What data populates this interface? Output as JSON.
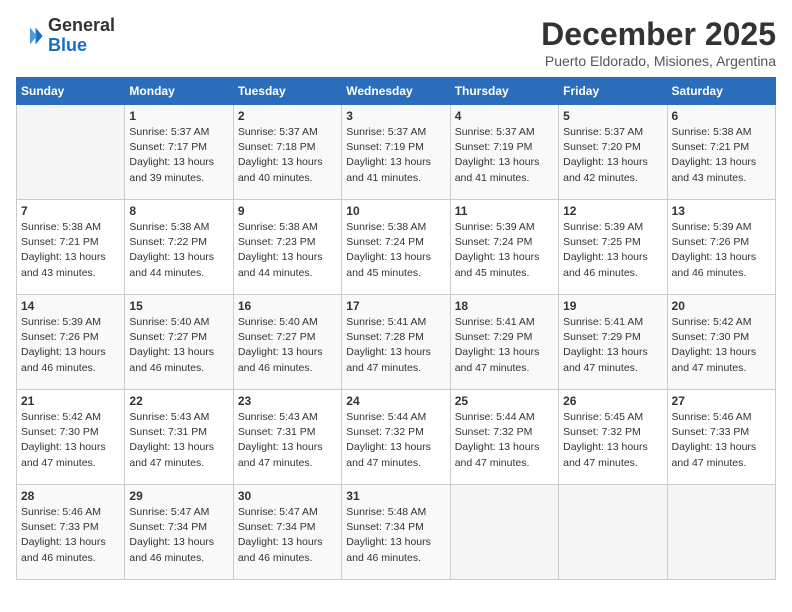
{
  "header": {
    "logo": {
      "general": "General",
      "blue": "Blue"
    },
    "title": "December 2025",
    "location": "Puerto Eldorado, Misiones, Argentina"
  },
  "calendar": {
    "days_of_week": [
      "Sunday",
      "Monday",
      "Tuesday",
      "Wednesday",
      "Thursday",
      "Friday",
      "Saturday"
    ],
    "weeks": [
      [
        {
          "day": "",
          "info": ""
        },
        {
          "day": "1",
          "info": "Sunrise: 5:37 AM\nSunset: 7:17 PM\nDaylight: 13 hours\nand 39 minutes."
        },
        {
          "day": "2",
          "info": "Sunrise: 5:37 AM\nSunset: 7:18 PM\nDaylight: 13 hours\nand 40 minutes."
        },
        {
          "day": "3",
          "info": "Sunrise: 5:37 AM\nSunset: 7:19 PM\nDaylight: 13 hours\nand 41 minutes."
        },
        {
          "day": "4",
          "info": "Sunrise: 5:37 AM\nSunset: 7:19 PM\nDaylight: 13 hours\nand 41 minutes."
        },
        {
          "day": "5",
          "info": "Sunrise: 5:37 AM\nSunset: 7:20 PM\nDaylight: 13 hours\nand 42 minutes."
        },
        {
          "day": "6",
          "info": "Sunrise: 5:38 AM\nSunset: 7:21 PM\nDaylight: 13 hours\nand 43 minutes."
        }
      ],
      [
        {
          "day": "7",
          "info": "Sunrise: 5:38 AM\nSunset: 7:21 PM\nDaylight: 13 hours\nand 43 minutes."
        },
        {
          "day": "8",
          "info": "Sunrise: 5:38 AM\nSunset: 7:22 PM\nDaylight: 13 hours\nand 44 minutes."
        },
        {
          "day": "9",
          "info": "Sunrise: 5:38 AM\nSunset: 7:23 PM\nDaylight: 13 hours\nand 44 minutes."
        },
        {
          "day": "10",
          "info": "Sunrise: 5:38 AM\nSunset: 7:24 PM\nDaylight: 13 hours\nand 45 minutes."
        },
        {
          "day": "11",
          "info": "Sunrise: 5:39 AM\nSunset: 7:24 PM\nDaylight: 13 hours\nand 45 minutes."
        },
        {
          "day": "12",
          "info": "Sunrise: 5:39 AM\nSunset: 7:25 PM\nDaylight: 13 hours\nand 46 minutes."
        },
        {
          "day": "13",
          "info": "Sunrise: 5:39 AM\nSunset: 7:26 PM\nDaylight: 13 hours\nand 46 minutes."
        }
      ],
      [
        {
          "day": "14",
          "info": "Sunrise: 5:39 AM\nSunset: 7:26 PM\nDaylight: 13 hours\nand 46 minutes."
        },
        {
          "day": "15",
          "info": "Sunrise: 5:40 AM\nSunset: 7:27 PM\nDaylight: 13 hours\nand 46 minutes."
        },
        {
          "day": "16",
          "info": "Sunrise: 5:40 AM\nSunset: 7:27 PM\nDaylight: 13 hours\nand 46 minutes."
        },
        {
          "day": "17",
          "info": "Sunrise: 5:41 AM\nSunset: 7:28 PM\nDaylight: 13 hours\nand 47 minutes."
        },
        {
          "day": "18",
          "info": "Sunrise: 5:41 AM\nSunset: 7:29 PM\nDaylight: 13 hours\nand 47 minutes."
        },
        {
          "day": "19",
          "info": "Sunrise: 5:41 AM\nSunset: 7:29 PM\nDaylight: 13 hours\nand 47 minutes."
        },
        {
          "day": "20",
          "info": "Sunrise: 5:42 AM\nSunset: 7:30 PM\nDaylight: 13 hours\nand 47 minutes."
        }
      ],
      [
        {
          "day": "21",
          "info": "Sunrise: 5:42 AM\nSunset: 7:30 PM\nDaylight: 13 hours\nand 47 minutes."
        },
        {
          "day": "22",
          "info": "Sunrise: 5:43 AM\nSunset: 7:31 PM\nDaylight: 13 hours\nand 47 minutes."
        },
        {
          "day": "23",
          "info": "Sunrise: 5:43 AM\nSunset: 7:31 PM\nDaylight: 13 hours\nand 47 minutes."
        },
        {
          "day": "24",
          "info": "Sunrise: 5:44 AM\nSunset: 7:32 PM\nDaylight: 13 hours\nand 47 minutes."
        },
        {
          "day": "25",
          "info": "Sunrise: 5:44 AM\nSunset: 7:32 PM\nDaylight: 13 hours\nand 47 minutes."
        },
        {
          "day": "26",
          "info": "Sunrise: 5:45 AM\nSunset: 7:32 PM\nDaylight: 13 hours\nand 47 minutes."
        },
        {
          "day": "27",
          "info": "Sunrise: 5:46 AM\nSunset: 7:33 PM\nDaylight: 13 hours\nand 47 minutes."
        }
      ],
      [
        {
          "day": "28",
          "info": "Sunrise: 5:46 AM\nSunset: 7:33 PM\nDaylight: 13 hours\nand 46 minutes."
        },
        {
          "day": "29",
          "info": "Sunrise: 5:47 AM\nSunset: 7:34 PM\nDaylight: 13 hours\nand 46 minutes."
        },
        {
          "day": "30",
          "info": "Sunrise: 5:47 AM\nSunset: 7:34 PM\nDaylight: 13 hours\nand 46 minutes."
        },
        {
          "day": "31",
          "info": "Sunrise: 5:48 AM\nSunset: 7:34 PM\nDaylight: 13 hours\nand 46 minutes."
        },
        {
          "day": "",
          "info": ""
        },
        {
          "day": "",
          "info": ""
        },
        {
          "day": "",
          "info": ""
        }
      ]
    ]
  }
}
